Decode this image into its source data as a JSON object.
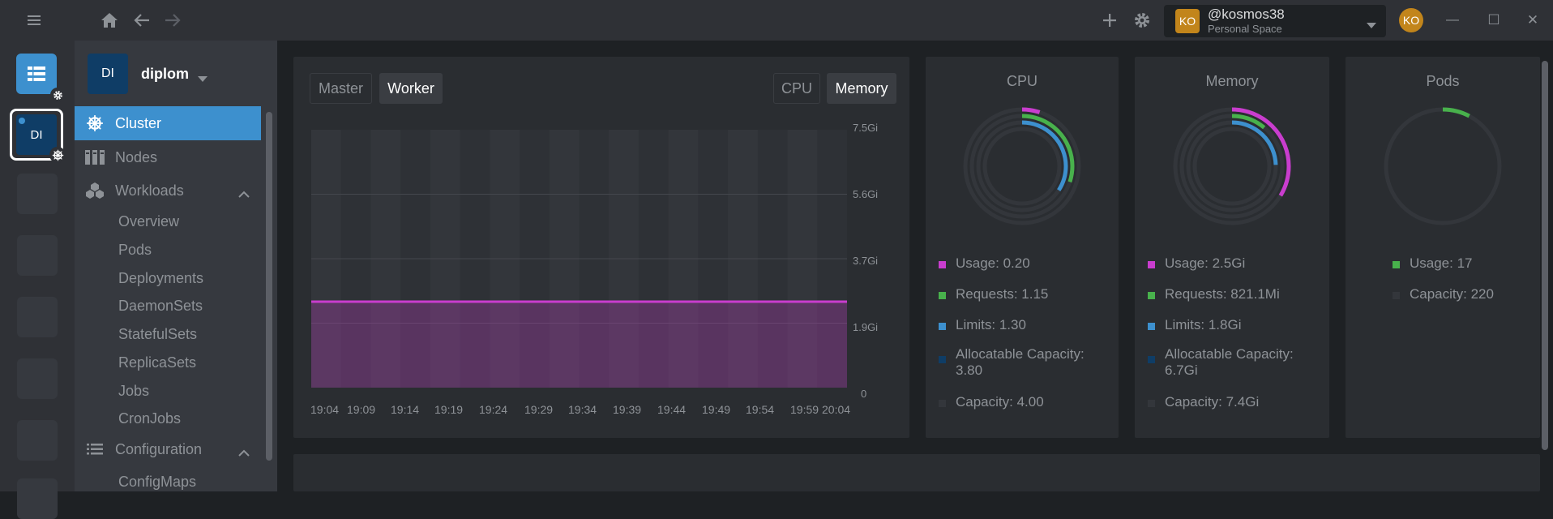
{
  "topbar": {
    "menu_icon": "hamburger-icon",
    "home_icon": "home-icon",
    "back_icon": "arrow-left-icon",
    "forward_icon": "arrow-right-icon",
    "add_icon": "plus-icon",
    "settings_icon": "gear-icon"
  },
  "user": {
    "avatar": "KO",
    "name": "@kosmos38",
    "space": "Personal Space",
    "avatar_right": "KO"
  },
  "window": {
    "minimize": "—",
    "maximize": "☐",
    "close": "✕"
  },
  "hotbar": {
    "cluster_badge": "DI"
  },
  "cluster": {
    "badge": "DI",
    "name": "diplom"
  },
  "nav": {
    "cluster": "Cluster",
    "nodes": "Nodes",
    "workloads": "Workloads",
    "workload_items": [
      "Overview",
      "Pods",
      "Deployments",
      "DaemonSets",
      "StatefulSets",
      "ReplicaSets",
      "Jobs",
      "CronJobs"
    ],
    "configuration": "Configuration",
    "config_items": [
      "ConfigMaps"
    ]
  },
  "chart_panel": {
    "tabs_left": [
      "Master",
      "Worker"
    ],
    "active_left": "Worker",
    "tabs_right": [
      "CPU",
      "Memory"
    ],
    "active_right": "Memory"
  },
  "chart_data": {
    "type": "area",
    "x": [
      "19:04",
      "19:09",
      "19:14",
      "19:19",
      "19:24",
      "19:29",
      "19:34",
      "19:39",
      "19:44",
      "19:49",
      "19:54",
      "19:59",
      "20:04"
    ],
    "yticks": [
      "7.5Gi",
      "5.6Gi",
      "3.7Gi",
      "1.9Gi",
      "0"
    ],
    "ylim": [
      0,
      7.5
    ],
    "series": [
      {
        "values": [
          2.5,
          2.5,
          2.5,
          2.5,
          2.5,
          2.5,
          2.5,
          2.5,
          2.5,
          2.5,
          2.5,
          2.5,
          2.5
        ],
        "color": "#c93dce"
      }
    ],
    "grid": true
  },
  "cpu": {
    "title": "CPU",
    "legend": [
      {
        "label": "Usage: 0.20",
        "color": "#c93dce"
      },
      {
        "label": "Requests: 1.15",
        "color": "#48b14c"
      },
      {
        "label": "Limits: 1.30",
        "color": "#3d90ce"
      },
      {
        "label": "Allocatable Capacity: 3.80",
        "color": "#0f3d66"
      },
      {
        "label": "Capacity: 4.00",
        "color": "#33363b"
      }
    ]
  },
  "memory": {
    "title": "Memory",
    "legend": [
      {
        "label": "Usage: 2.5Gi",
        "color": "#c93dce"
      },
      {
        "label": "Requests: 821.1Mi",
        "color": "#48b14c"
      },
      {
        "label": "Limits: 1.8Gi",
        "color": "#3d90ce"
      },
      {
        "label": "Allocatable Capacity: 6.7Gi",
        "color": "#0f3d66"
      },
      {
        "label": "Capacity: 7.4Gi",
        "color": "#33363b"
      }
    ]
  },
  "pods": {
    "title": "Pods",
    "legend": [
      {
        "label": "Usage: 17",
        "color": "#48b14c"
      },
      {
        "label": "Capacity: 220",
        "color": "#33363b"
      }
    ]
  }
}
